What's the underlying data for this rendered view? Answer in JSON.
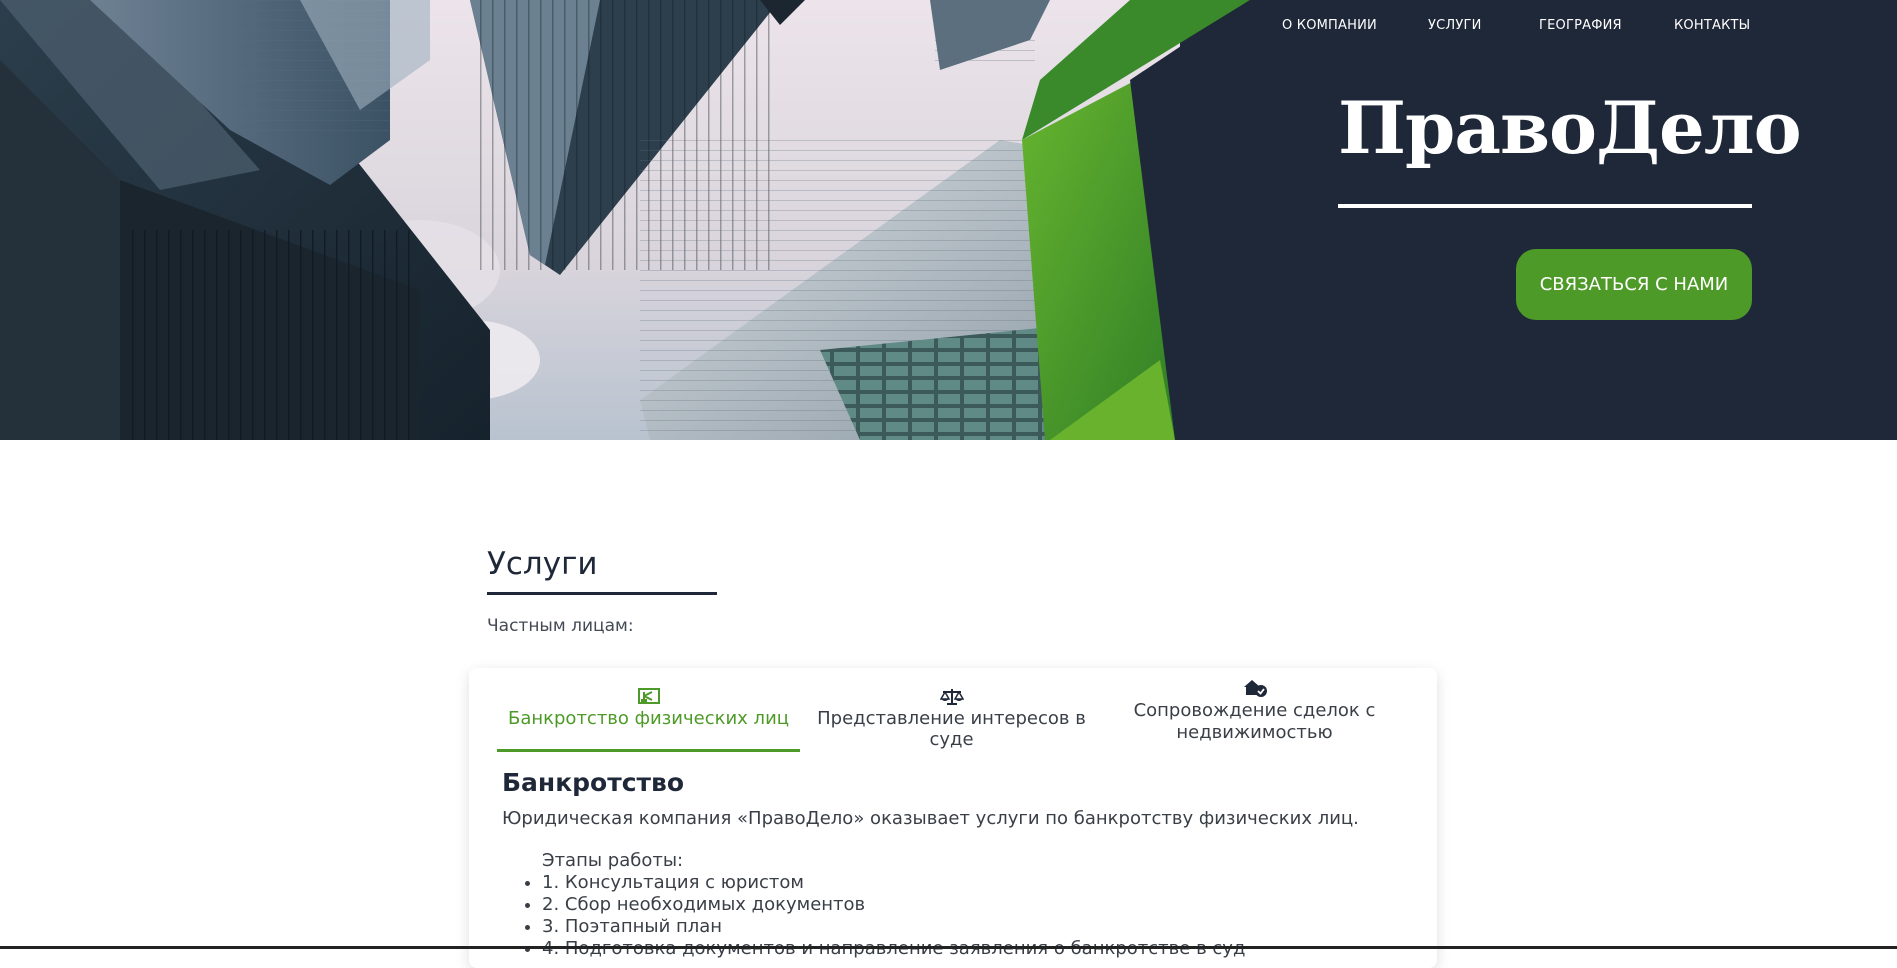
{
  "nav": {
    "about": "О КОМПАНИИ",
    "services": "УСЛУГИ",
    "geography": "ГЕОГРАФИЯ",
    "contacts": "КОНТАКТЫ"
  },
  "hero": {
    "brand": "ПравоДело",
    "cta_label": "СВЯЗАТЬСЯ С НАМИ",
    "background_color": "#1f2838",
    "accent_color": "#4e9a28"
  },
  "services": {
    "title": "Услуги",
    "subtitle": "Частным лицам:",
    "tabs": [
      {
        "label": "Банкротство физических лиц",
        "icon": "money-icon",
        "active": true
      },
      {
        "label": "Представление интересов в суде",
        "icon": "scales-icon",
        "active": false
      },
      {
        "label": "Сопровождение сделок с недвижимостью",
        "icon": "house-check-icon",
        "active": false
      }
    ],
    "panel": {
      "title": "Банкротство",
      "description": "Юридическая компания «ПравоДело» оказывает услуги по банкротству физических лиц.",
      "steps_title": "Этапы работы:",
      "steps": [
        "1. Консультация с юристом",
        "2. Сбор необходимых документов",
        "3. Поэтапный план",
        "4. Подготовка документов и направление заявления о банкротстве в суд"
      ]
    }
  }
}
